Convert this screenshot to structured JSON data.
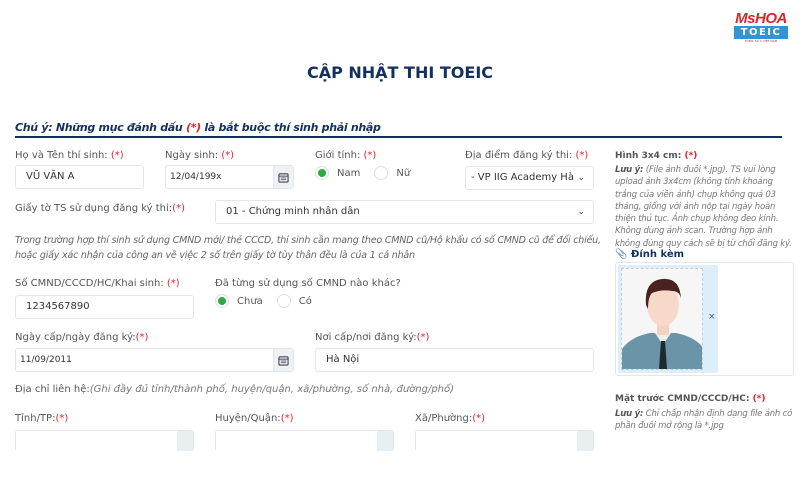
{
  "logo": {
    "top": "MsHOA",
    "mid": "TOEIC",
    "bottom": "TOEIC SỐ 1 VIỆT NAM"
  },
  "page_title": "CẬP NHẬT THI TOEIC",
  "notice": {
    "prefix": "Chú ý: Những mục đánh dấu ",
    "required_mark": "(*)",
    "suffix": " là bắt buộc thí sinh phải nhập"
  },
  "required_mark": "(*)",
  "form": {
    "full_name": {
      "label": "Họ và Tên thí sinh: ",
      "value": "VŨ VĂN A"
    },
    "dob": {
      "label": "Ngày sinh: ",
      "value": "12/04/199x"
    },
    "gender": {
      "label": "Giới tính: ",
      "options": [
        "Nam",
        "Nữ"
      ],
      "selected": "Nam"
    },
    "exam_location": {
      "label": "Địa điểm đăng ký thi: ",
      "value": "- VP IIG Academy Hà"
    },
    "id_document": {
      "label": "Giấy tờ TS sử dụng đăng ký thi:",
      "value": "01 - Chứng minh nhân dân"
    },
    "id_hint": "Trong trường hợp thí sinh sử dụng CMND mới/ thẻ CCCD, thí sinh cần mang theo CMND cũ/Hộ khẩu có số CMND cũ để đối chiếu, hoặc giấy xác nhận của công an về việc 2 số trên giấy tờ tùy thân đều là của 1 cá nhân",
    "id_number": {
      "label": "Số CMND/CCCD/HC/Khai sinh: ",
      "value": "1234567890"
    },
    "other_id": {
      "label": "Đã từng sử dụng số CMND nào khác?",
      "options": [
        "Chưa",
        "Có"
      ],
      "selected": "Chưa"
    },
    "issue_date": {
      "label": "Ngày cấp/ngày đăng ký:",
      "value": "11/09/2011"
    },
    "issue_place": {
      "label": "Nơi cấp/nơi đăng ký:",
      "value": "Hà Nội"
    },
    "address": {
      "label": "Địa chỉ liên hệ:",
      "hint": "(Ghi đầy đủ tỉnh/thành phố, huyện/quận, xã/phường, số nhà, đường/phố)"
    },
    "province": {
      "label": "Tỉnh/TP:"
    },
    "district": {
      "label": "Huyện/Quận:"
    },
    "ward": {
      "label": "Xã/Phường:"
    }
  },
  "sidebar": {
    "photo": {
      "title": "Hình 3x4 cm: ",
      "note_label": "Lưu ý:",
      "note": " (File ảnh đuôi *.jpg). TS vui lòng upload ảnh 3x4cm (không tính khoảng trắng của viền ảnh) chụp không quá 03 tháng, giống với ảnh nộp tại ngày hoàn thiện thủ tục. Ảnh chụp không đeo kính. Không dùng ảnh scan. Trường hợp ảnh không đúng quy cách sẽ bị từ chối đăng ký.",
      "attach_label": "Đính kèm",
      "remove": "×"
    },
    "id_front": {
      "title": "Mặt trước CMND/CCCD/HC: ",
      "note_label": "Lưu ý:",
      "note": " Chỉ chấp nhận định dạng file ảnh có phần đuôi mở rộng là *.jpg"
    }
  }
}
